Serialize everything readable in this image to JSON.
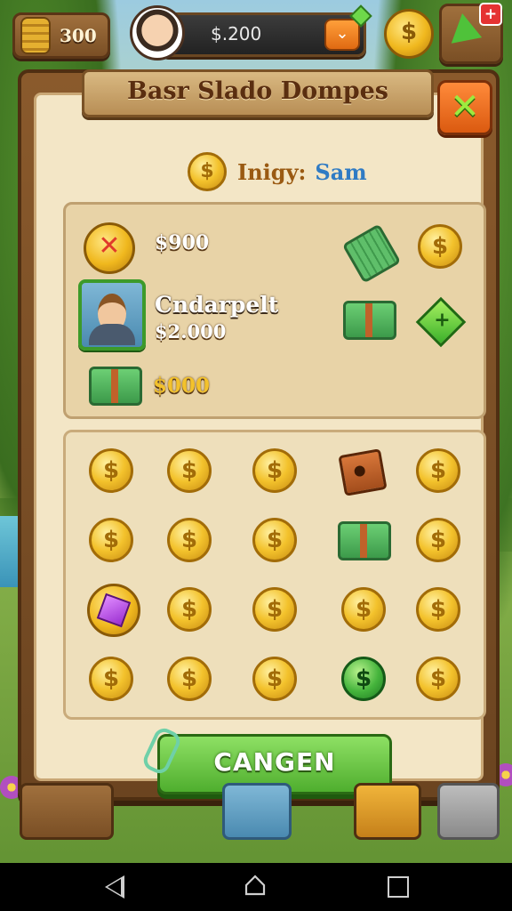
{
  "hud": {
    "resource_value": "300",
    "money_value": "$.200",
    "dropdown_glyph": "⌄",
    "coin_glyph": "$",
    "notification_badge": "+"
  },
  "panel": {
    "title": "Basr Slado Dompes",
    "close_glyph": "✕",
    "player_label": "Inigy:",
    "player_name": "Sam"
  },
  "offers": {
    "row1_value": "$900",
    "row2_name": "Cndarpelt",
    "row2_value": "$2.000",
    "row3_value": "$000"
  },
  "grid": {
    "coin_glyph": "$",
    "plus_glyph": "+"
  },
  "confirm_label": "CANGEN",
  "colors": {
    "confirm_green": "#4fae2e",
    "close_orange": "#db5a10",
    "panel_brown": "#6b4420",
    "parchment": "#f3e6c6"
  }
}
